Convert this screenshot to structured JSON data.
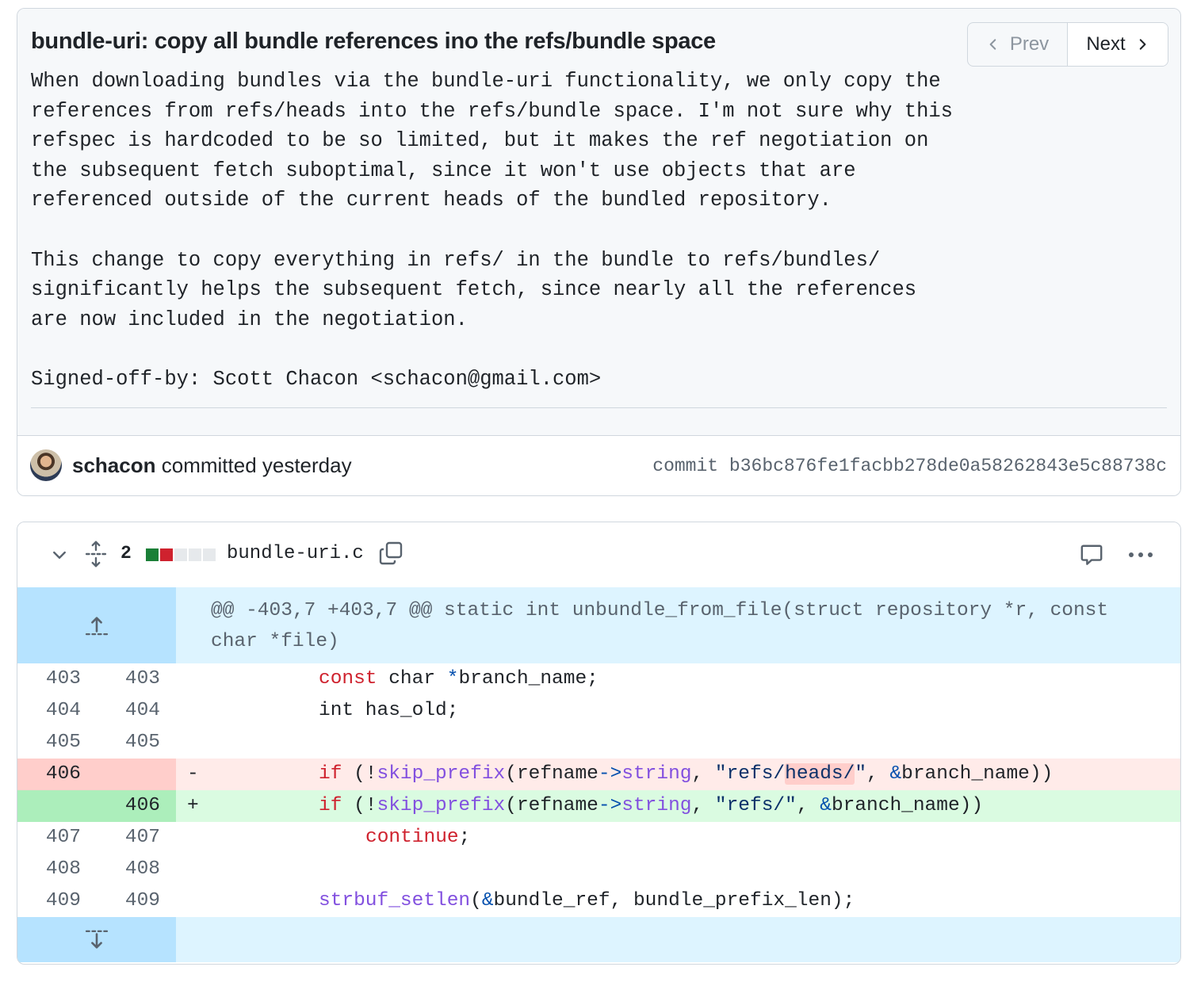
{
  "commit": {
    "title": "bundle-uri: copy all bundle references ino the refs/bundle space",
    "message_lines": [
      "When downloading bundles via the bundle-uri functionality, we only copy the",
      "references from refs/heads into the refs/bundle space. I'm not sure why this",
      "refspec is hardcoded to be so limited, but it makes the ref negotiation on",
      "the subsequent fetch suboptimal, since it won't use objects that are",
      "referenced outside of the current heads of the bundled repository.",
      "",
      "This change to copy everything in refs/ in the bundle to refs/bundles/",
      "significantly helps the subsequent fetch, since nearly all the references",
      "are now included in the negotiation.",
      "",
      "Signed-off-by: Scott Chacon <schacon@gmail.com>"
    ],
    "author": "schacon",
    "committed_text": "committed yesterday",
    "sha_label": "commit",
    "sha": "b36bc876fe1facbb278de0a58262843e5c88738c"
  },
  "pager": {
    "prev_label": "Prev",
    "next_label": "Next"
  },
  "file": {
    "name": "bundle-uri.c",
    "change_count": "2",
    "diffstat": [
      "add",
      "del",
      "neutral",
      "neutral",
      "neutral"
    ],
    "colors": {
      "add": "#1a7f37",
      "del": "#cf222e",
      "neutral": "#e6e9ec"
    }
  },
  "hunk": {
    "header": "@@ -403,7 +403,7 @@ static int unbundle_from_file(struct repository *r, const char *file)"
  },
  "lines": [
    {
      "type": "ctx",
      "old": "403",
      "new": "403",
      "marker": "",
      "tokens": [
        [
          "sp",
          "\t\t"
        ],
        [
          "kw",
          "const"
        ],
        [
          "pl",
          " char "
        ],
        [
          "op",
          "*"
        ],
        [
          "pl",
          "branch_name;"
        ]
      ]
    },
    {
      "type": "ctx",
      "old": "404",
      "new": "404",
      "marker": "",
      "tokens": [
        [
          "sp",
          "\t\t"
        ],
        [
          "pl",
          "int has_old;"
        ]
      ]
    },
    {
      "type": "ctx",
      "old": "405",
      "new": "405",
      "marker": "",
      "tokens": []
    },
    {
      "type": "del",
      "old": "406",
      "new": "",
      "marker": "-",
      "tokens": [
        [
          "sp",
          "\t\t"
        ],
        [
          "kw",
          "if"
        ],
        [
          "pl",
          " (!"
        ],
        [
          "fn",
          "skip_prefix"
        ],
        [
          "pl",
          "(refname"
        ],
        [
          "op",
          "->"
        ],
        [
          "fn",
          "string"
        ],
        [
          "pl",
          ", "
        ],
        [
          "str",
          "\"refs/"
        ],
        [
          "hl",
          "heads/"
        ],
        [
          "str",
          "\""
        ],
        [
          "pl",
          ", "
        ],
        [
          "op",
          "&"
        ],
        [
          "pl",
          "branch_name))"
        ]
      ]
    },
    {
      "type": "add",
      "old": "",
      "new": "406",
      "marker": "+",
      "tokens": [
        [
          "sp",
          "\t\t"
        ],
        [
          "kw",
          "if"
        ],
        [
          "pl",
          " (!"
        ],
        [
          "fn",
          "skip_prefix"
        ],
        [
          "pl",
          "(refname"
        ],
        [
          "op",
          "->"
        ],
        [
          "fn",
          "string"
        ],
        [
          "pl",
          ", "
        ],
        [
          "str",
          "\"refs/\""
        ],
        [
          "pl",
          ", "
        ],
        [
          "op",
          "&"
        ],
        [
          "pl",
          "branch_name))"
        ]
      ]
    },
    {
      "type": "ctx",
      "old": "407",
      "new": "407",
      "marker": "",
      "tokens": [
        [
          "sp",
          "\t\t\t"
        ],
        [
          "kw",
          "continue"
        ],
        [
          "pl",
          ";"
        ]
      ]
    },
    {
      "type": "ctx",
      "old": "408",
      "new": "408",
      "marker": "",
      "tokens": []
    },
    {
      "type": "ctx",
      "old": "409",
      "new": "409",
      "marker": "",
      "tokens": [
        [
          "sp",
          "\t\t"
        ],
        [
          "fn",
          "strbuf_setlen"
        ],
        [
          "pl",
          "("
        ],
        [
          "op",
          "&"
        ],
        [
          "pl",
          "bundle_ref, bundle_prefix_len);"
        ]
      ]
    }
  ],
  "icons": {
    "prev": "chevron-left-icon",
    "next": "chevron-right-icon",
    "collapse": "chevron-down-icon",
    "expand_all": "unfold-icon",
    "copy": "copy-icon",
    "comment": "comment-icon",
    "more": "kebab-horizontal-icon",
    "expand_up": "fold-up-icon",
    "expand_down": "fold-down-icon"
  }
}
